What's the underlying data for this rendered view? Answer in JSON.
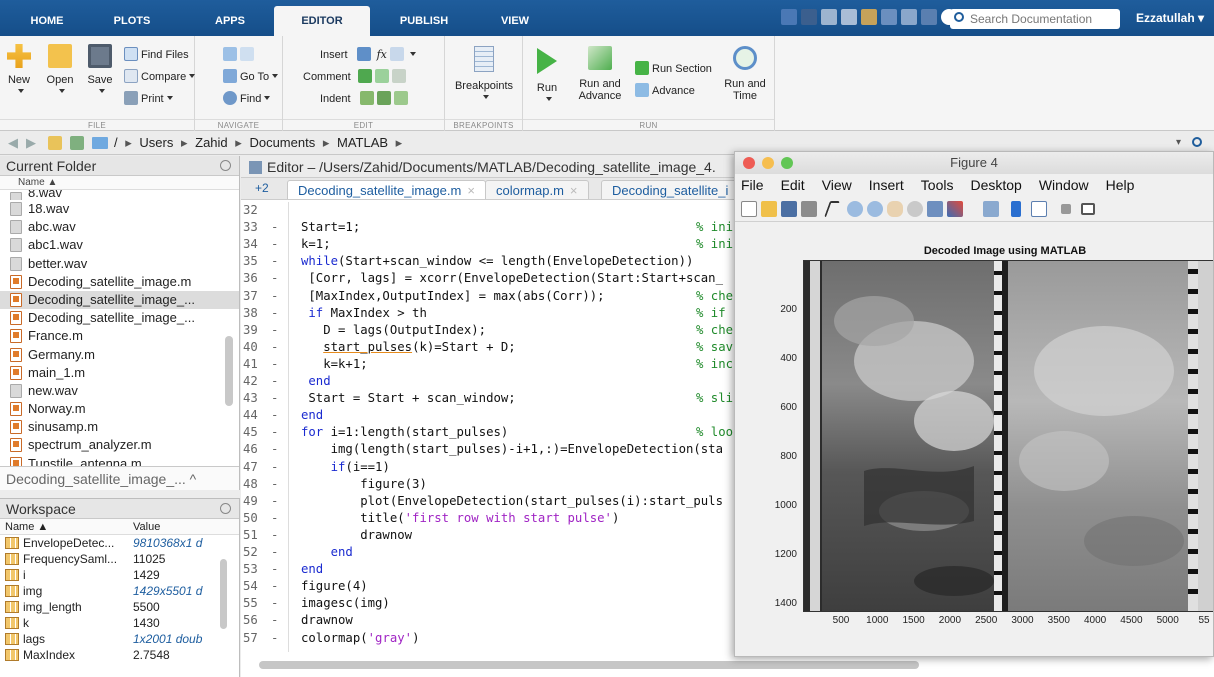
{
  "tabs": [
    "HOME",
    "PLOTS",
    "APPS",
    "EDITOR",
    "PUBLISH",
    "VIEW"
  ],
  "search": {
    "placeholder": "Search Documentation"
  },
  "user": "Ezzatullah ▾",
  "ribbon": {
    "file": {
      "new": "New",
      "open": "Open",
      "save": "Save",
      "find_files": "Find Files",
      "compare": "Compare",
      "print": "Print",
      "label": "FILE"
    },
    "navigate": {
      "goto": "Go To",
      "find": "Find",
      "label": "NAVIGATE"
    },
    "edit": {
      "insert": "Insert",
      "comment": "Comment",
      "indent": "Indent",
      "label": "EDIT"
    },
    "breakpoints": {
      "btn": "Breakpoints",
      "label": "BREAKPOINTS"
    },
    "run": {
      "run": "Run",
      "run_advance_1": "Run and",
      "run_advance_2": "Advance",
      "run_section": "Run Section",
      "advance": "Advance",
      "run_time_1": "Run and",
      "run_time_2": "Time",
      "label": "RUN"
    }
  },
  "address": {
    "path": [
      "/",
      "Users",
      "Zahid",
      "Documents",
      "MATLAB"
    ]
  },
  "current_folder": {
    "title": "Current Folder",
    "col_name": "Name ▲",
    "files": [
      {
        "name": "8.wav",
        "type": "wav"
      },
      {
        "name": "18.wav",
        "type": "wav"
      },
      {
        "name": "abc.wav",
        "type": "wav"
      },
      {
        "name": "abc1.wav",
        "type": "wav"
      },
      {
        "name": "better.wav",
        "type": "wav"
      },
      {
        "name": "Decoding_satellite_image.m",
        "type": "m"
      },
      {
        "name": "Decoding_satellite_image_...",
        "type": "m"
      },
      {
        "name": "Decoding_satellite_image_...",
        "type": "m"
      },
      {
        "name": "France.m",
        "type": "m"
      },
      {
        "name": "Germany.m",
        "type": "m"
      },
      {
        "name": "main_1.m",
        "type": "m"
      },
      {
        "name": "new.wav",
        "type": "wav"
      },
      {
        "name": "Norway.m",
        "type": "m"
      },
      {
        "name": "sinusamp.m",
        "type": "m"
      },
      {
        "name": "spectrum_analyzer.m",
        "type": "m"
      },
      {
        "name": "Tunstile_antenna.m",
        "type": "m"
      }
    ],
    "detail": "Decoding_satellite_image_... ^"
  },
  "workspace": {
    "title": "Workspace",
    "col_name": "Name ▲",
    "col_value": "Value",
    "vars": [
      {
        "name": "EnvelopeDetec...",
        "value": "9810368x1 d",
        "italic": true
      },
      {
        "name": "FrequencySaml...",
        "value": "11025",
        "italic": false
      },
      {
        "name": "i",
        "value": "1429",
        "italic": false
      },
      {
        "name": "img",
        "value": "1429x5501 d",
        "italic": true
      },
      {
        "name": "img_length",
        "value": "5500",
        "italic": false
      },
      {
        "name": "k",
        "value": "1430",
        "italic": false
      },
      {
        "name": "lags",
        "value": "1x2001 doub",
        "italic": true
      },
      {
        "name": "MaxIndex",
        "value": "2.7548",
        "italic": false
      }
    ]
  },
  "editor": {
    "title": "Editor – /Users/Zahid/Documents/MATLAB/Decoding_satellite_image_4.",
    "tab_count": "+2",
    "tabs": [
      "Decoding_satellite_image.m",
      "colormap.m",
      "Decoding_satellite_i"
    ],
    "lines": [
      {
        "n": "32",
        "dash": "",
        "code": "",
        "cmt": ""
      },
      {
        "n": "33",
        "dash": "-",
        "code": "Start=1;",
        "cmt": "% ini"
      },
      {
        "n": "34",
        "dash": "-",
        "code": "k=1;",
        "cmt": "% ini"
      },
      {
        "n": "35",
        "dash": "-",
        "code": "while(Start+scan_window <= length(EnvelopeDetection))",
        "cmt": ""
      },
      {
        "n": "36",
        "dash": "-",
        "code": " [Corr, lags] = xcorr(EnvelopeDetection(Start:Start+scan_",
        "cmt": ""
      },
      {
        "n": "37",
        "dash": "-",
        "code": " [MaxIndex,OutputIndex] = max(abs(Corr));",
        "cmt": "% che"
      },
      {
        "n": "38",
        "dash": "-",
        "code": " if MaxIndex > th",
        "cmt": "% if"
      },
      {
        "n": "39",
        "dash": "-",
        "code": "   D = lags(OutputIndex);",
        "cmt": "% che"
      },
      {
        "n": "40",
        "dash": "-",
        "code": "   start_pulses(k)=Start + D;",
        "cmt": "% sav"
      },
      {
        "n": "41",
        "dash": "-",
        "code": "   k=k+1;",
        "cmt": "% inc"
      },
      {
        "n": "42",
        "dash": "-",
        "code": " end",
        "cmt": ""
      },
      {
        "n": "43",
        "dash": "-",
        "code": " Start = Start + scan_window;",
        "cmt": "% sli"
      },
      {
        "n": "44",
        "dash": "-",
        "code": "end",
        "cmt": ""
      },
      {
        "n": "45",
        "dash": "-",
        "code": "for i=1:length(start_pulses)",
        "cmt": "% loo"
      },
      {
        "n": "46",
        "dash": "-",
        "code": "    img(length(start_pulses)-i+1,:)=EnvelopeDetection(sta",
        "cmt": ""
      },
      {
        "n": "47",
        "dash": "-",
        "code": "    if(i==1)",
        "cmt": ""
      },
      {
        "n": "48",
        "dash": "-",
        "code": "        figure(3)",
        "cmt": ""
      },
      {
        "n": "49",
        "dash": "-",
        "code": "        plot(EnvelopeDetection(start_pulses(i):start_puls",
        "cmt": ""
      },
      {
        "n": "50",
        "dash": "-",
        "code": "        title('first row with start pulse')",
        "cmt": ""
      },
      {
        "n": "51",
        "dash": "-",
        "code": "        drawnow",
        "cmt": ""
      },
      {
        "n": "52",
        "dash": "-",
        "code": "    end",
        "cmt": ""
      },
      {
        "n": "53",
        "dash": "-",
        "code": "end",
        "cmt": ""
      },
      {
        "n": "54",
        "dash": "-",
        "code": "figure(4)",
        "cmt": ""
      },
      {
        "n": "55",
        "dash": "-",
        "code": "imagesc(img)",
        "cmt": ""
      },
      {
        "n": "56",
        "dash": "-",
        "code": "drawnow",
        "cmt": ""
      },
      {
        "n": "57",
        "dash": "-",
        "code": "colormap('gray')",
        "cmt": ""
      }
    ]
  },
  "figure": {
    "window_title": "Figure 4",
    "menu": [
      "File",
      "Edit",
      "View",
      "Insert",
      "Tools",
      "Desktop",
      "Window",
      "Help"
    ],
    "plot_title": "Decoded Image using MATLAB",
    "y_ticks": [
      "200",
      "400",
      "600",
      "800",
      "1000",
      "1200",
      "1400"
    ],
    "x_ticks": [
      "500",
      "1000",
      "1500",
      "2000",
      "2500",
      "3000",
      "3500",
      "4000",
      "4500",
      "5000",
      "55"
    ]
  },
  "colors": {
    "accent": "#1f5d9c",
    "keyword": "#1b2bd0",
    "comment": "#1f8a2a",
    "string": "#a024c4"
  }
}
